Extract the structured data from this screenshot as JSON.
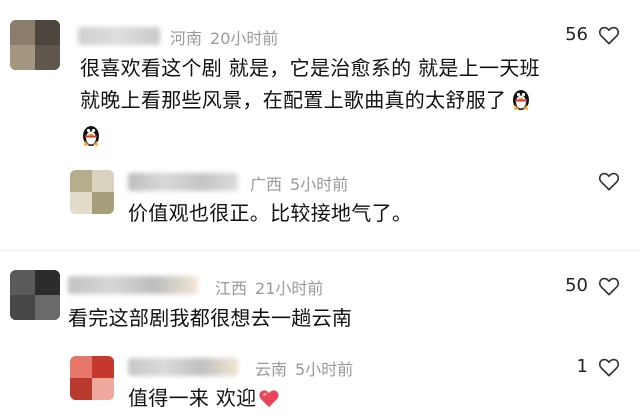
{
  "comments": [
    {
      "region": "河南",
      "time": "20小时前",
      "likes": "56",
      "text_line1": "很喜欢看这个剧 就是，它是治愈系的 就是上一天班",
      "text_line2": "就晚上看那些风景，在配置上歌曲真的太舒服了",
      "emoji_inline": "penguin-emoji",
      "emoji_line3": "penguin-emoji",
      "reply": {
        "region": "广西",
        "time": "5小时前",
        "likes": "",
        "text": "价值观也很正。比较接地气了。"
      }
    },
    {
      "region": "江西",
      "time": "21小时前",
      "likes": "50",
      "text_line1": "看完这部剧我都很想去一趟云南",
      "reply": {
        "region": "云南",
        "time": "5小时前",
        "likes": "1",
        "text": "值得一来 欢迎",
        "emoji": "heart-emoji"
      }
    }
  ],
  "colors": {
    "meta": "#9a9a9a",
    "heart_emoji": "#e8455a",
    "like_heart": "#333333"
  }
}
